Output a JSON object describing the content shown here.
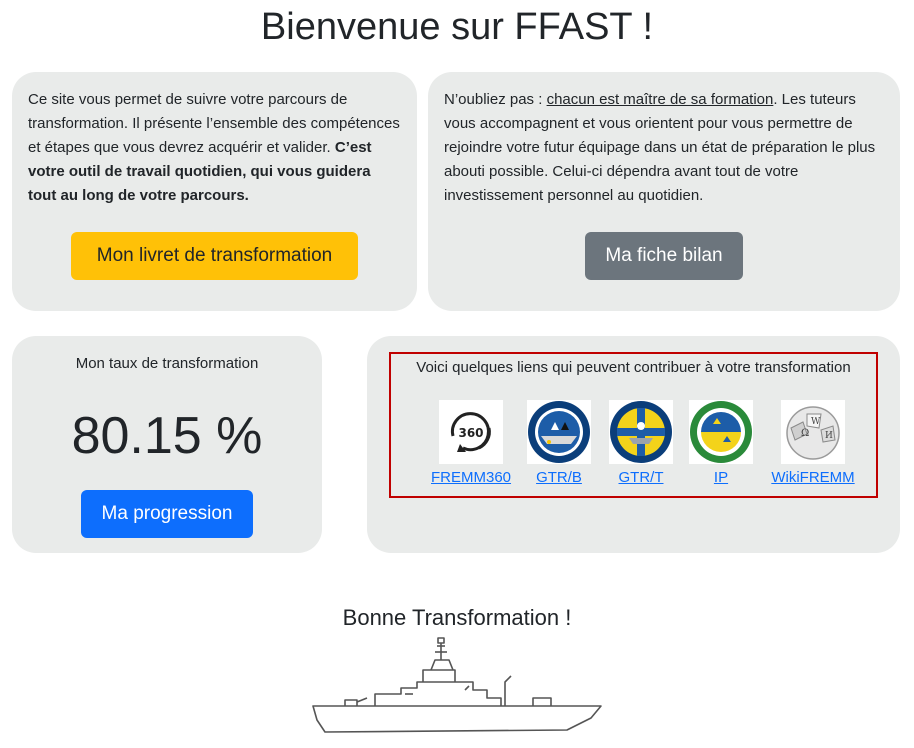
{
  "page": {
    "title": "Bienvenue sur FFAST !"
  },
  "intro_card": {
    "text_plain": "Ce site vous permet de suivre votre parcours de transformation. Il présente l’ensemble des compétences et étapes que vous devrez acquérir et valider.",
    "text_bold": "C’est votre outil de travail quotidien, qui vous guidera tout au long de votre parcours.",
    "button_label": "Mon livret de transformation",
    "button_color": "#ffc107"
  },
  "reminder_card": {
    "text_lead": "N’oubliez pas :",
    "text_underlined": "chacun est maître de sa formation",
    "text_rest": ". Les tuteurs vous accompagnent et vous orientent pour vous permettre de rejoindre votre futur équipage dans un état de préparation le plus abouti possible. Celui-ci dépendra avant tout de votre investissement personnel au quotidien.",
    "button_label": "Ma fiche bilan",
    "button_color": "#6c757d"
  },
  "progress_card": {
    "label": "Mon taux de transformation",
    "value": "80.15 %",
    "button_label": "Ma progression",
    "button_color": "#0d6efd"
  },
  "links_card": {
    "title": "Voici quelques liens qui peuvent contribuer à votre transformation",
    "links": [
      {
        "label": "FREMM360",
        "icon": "360-icon"
      },
      {
        "label": "GTR/B",
        "icon": "gtr-b-badge-icon"
      },
      {
        "label": "GTR/T",
        "icon": "gtr-t-badge-icon"
      },
      {
        "label": "IP",
        "icon": "ip-badge-icon"
      },
      {
        "label": "WikiFREMM",
        "icon": "wikipedia-globe-icon"
      }
    ]
  },
  "footer": {
    "message": "Bonne Transformation !",
    "illustration": "frigate-ship-icon"
  }
}
